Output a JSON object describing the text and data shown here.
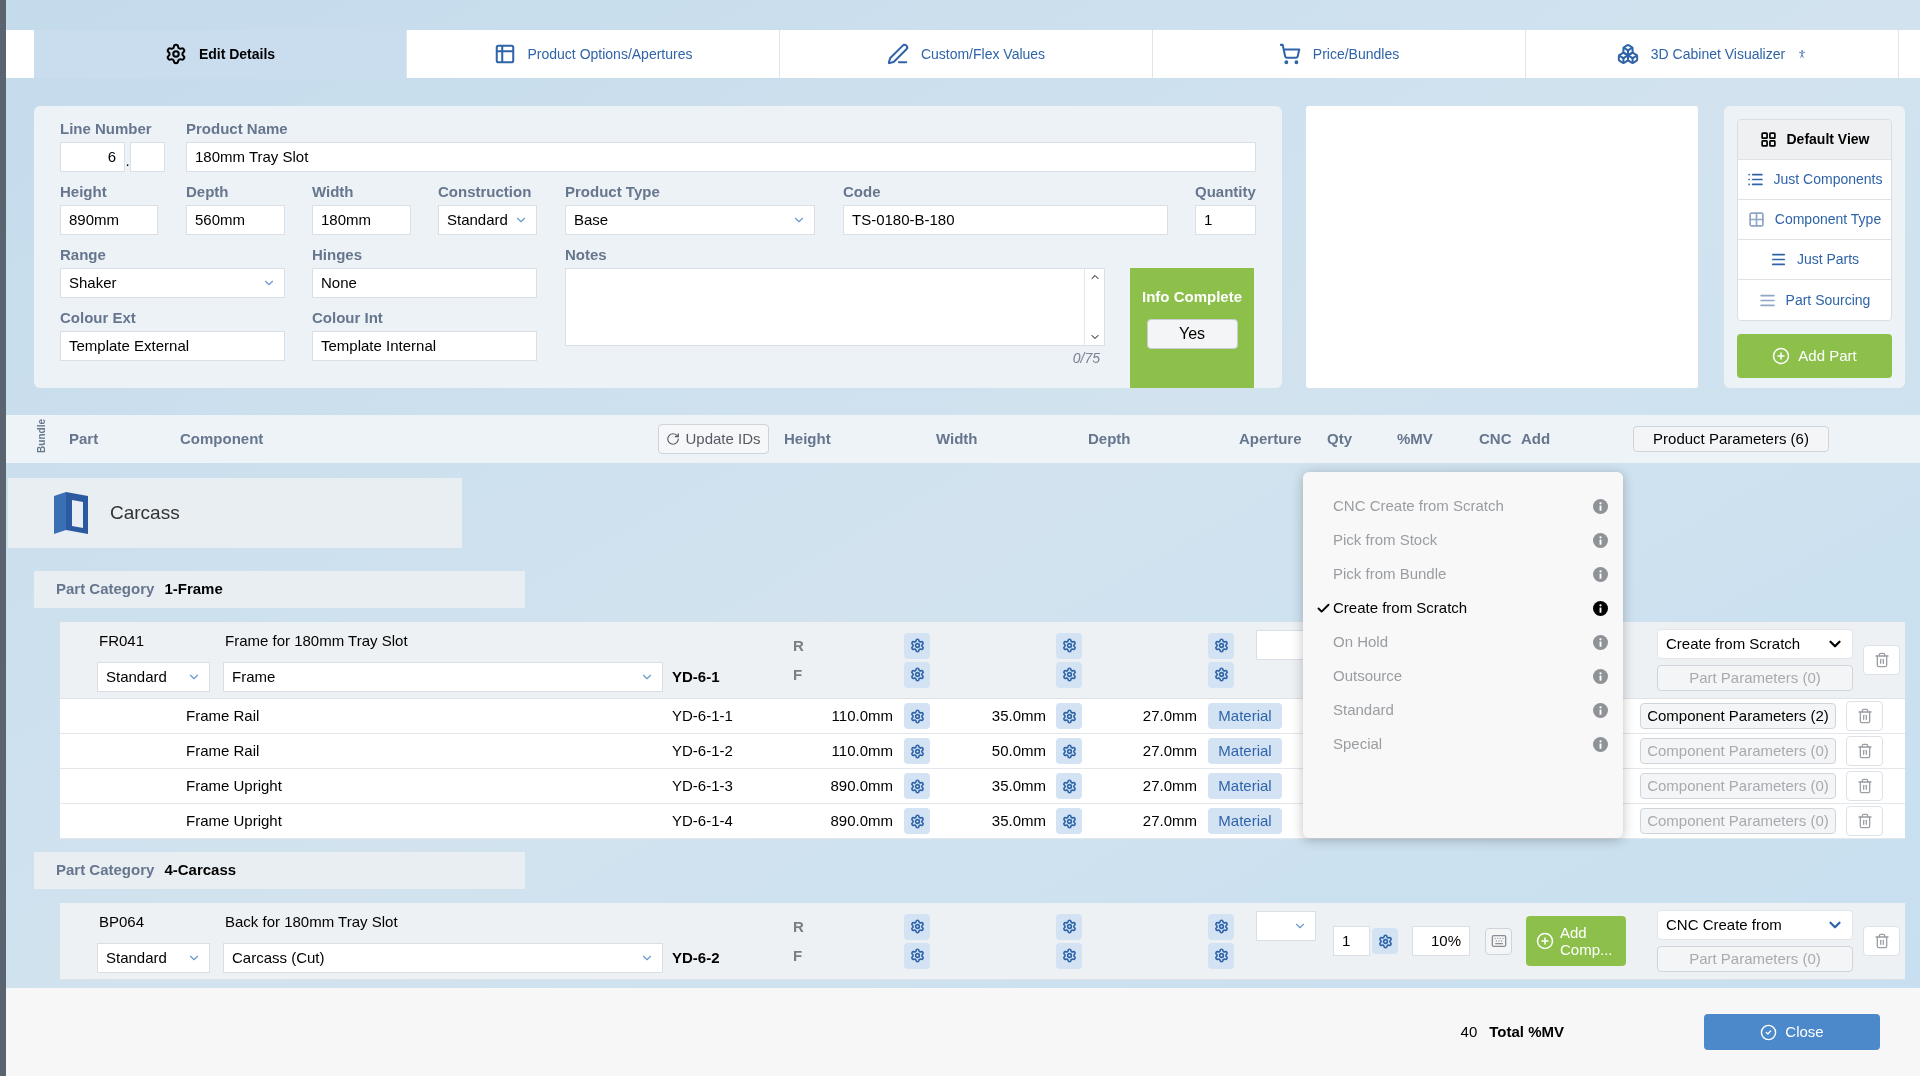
{
  "tabs": [
    {
      "label": "Edit Details",
      "selected": true
    },
    {
      "label": "Product Options/Apertures",
      "selected": false
    },
    {
      "label": "Custom/Flex Values",
      "selected": false
    },
    {
      "label": "Price/Bundles",
      "selected": false
    },
    {
      "label": "3D Cabinet Visualizer",
      "selected": false
    }
  ],
  "form": {
    "line_number": {
      "label": "Line Number",
      "value": "6",
      "separator": "."
    },
    "product_name": {
      "label": "Product Name",
      "value": "180mm Tray Slot"
    },
    "height": {
      "label": "Height",
      "value": "890mm"
    },
    "depth": {
      "label": "Depth",
      "value": "560mm"
    },
    "width": {
      "label": "Width",
      "value": "180mm"
    },
    "construction": {
      "label": "Construction",
      "value": "Standard"
    },
    "product_type": {
      "label": "Product Type",
      "value": "Base"
    },
    "code": {
      "label": "Code",
      "value": "TS-0180-B-180"
    },
    "quantity": {
      "label": "Quantity",
      "value": "1"
    },
    "range": {
      "label": "Range",
      "value": "Shaker"
    },
    "hinges": {
      "label": "Hinges",
      "value": "None"
    },
    "colour_ext": {
      "label": "Colour Ext",
      "value": "Template External"
    },
    "colour_int": {
      "label": "Colour Int",
      "value": "Template Internal"
    },
    "notes": {
      "label": "Notes",
      "counter": "0/75"
    }
  },
  "info_complete": {
    "label": "Info Complete",
    "button": "Yes"
  },
  "views": [
    {
      "label": "Default View",
      "selected": true
    },
    {
      "label": "Just Components",
      "selected": false
    },
    {
      "label": "Component Type",
      "selected": false
    },
    {
      "label": "Just Parts",
      "selected": false
    },
    {
      "label": "Part Sourcing",
      "selected": false
    }
  ],
  "add_part": "Add Part",
  "table_header": {
    "bundle": "Bundle",
    "columns": [
      "Part",
      "Component",
      "Height",
      "Width",
      "Depth",
      "Aperture",
      "Qty",
      "%MV",
      "CNC",
      "Add"
    ],
    "update_ids": "Update IDs",
    "product_parameters": "Product Parameters (6)"
  },
  "section": {
    "title": "Carcass"
  },
  "categories": [
    {
      "label": "Part Category",
      "name": "1-Frame",
      "parts": [
        {
          "code": "FR041",
          "description": "Frame for 180mm Tray Slot",
          "construction": "Standard",
          "component_type": "Frame",
          "id": "YD-6-1",
          "row_labels": [
            "R",
            "F"
          ],
          "source": "Create from Scratch",
          "part_parameters": {
            "label": "Part Parameters (0)",
            "disabled": true
          },
          "components": [
            {
              "name": "Frame Rail",
              "id": "YD-6-1-1",
              "height": "110.0mm",
              "width": "35.0mm",
              "depth": "27.0mm",
              "material": "Material",
              "parameters": {
                "label": "Component Parameters (2)",
                "disabled": false
              }
            },
            {
              "name": "Frame Rail",
              "id": "YD-6-1-2",
              "height": "110.0mm",
              "width": "50.0mm",
              "depth": "27.0mm",
              "material": "Material",
              "parameters": {
                "label": "Component Parameters (0)",
                "disabled": true
              }
            },
            {
              "name": "Frame Upright",
              "id": "YD-6-1-3",
              "height": "890.0mm",
              "width": "35.0mm",
              "depth": "27.0mm",
              "material": "Material",
              "parameters": {
                "label": "Component Parameters (0)",
                "disabled": true
              }
            },
            {
              "name": "Frame Upright",
              "id": "YD-6-1-4",
              "height": "890.0mm",
              "width": "35.0mm",
              "depth": "27.0mm",
              "material": "Material",
              "parameters": {
                "label": "Component Parameters (0)",
                "disabled": true
              }
            }
          ]
        }
      ]
    },
    {
      "label": "Part Category",
      "name": "4-Carcass",
      "parts": [
        {
          "code": "BP064",
          "description": "Back for 180mm Tray Slot",
          "construction": "Standard",
          "component_type": "Carcass (Cut)",
          "id": "YD-6-2",
          "row_labels": [
            "R",
            "F"
          ],
          "qty": "1",
          "mv": "10%",
          "add": "Add Comp...",
          "source": "CNC Create from",
          "part_parameters": {
            "label": "Part Parameters (0)",
            "disabled": true
          }
        }
      ]
    }
  ],
  "source_menu": {
    "options": [
      {
        "label": "CNC Create from Scratch",
        "selected": false
      },
      {
        "label": "Pick from Stock",
        "selected": false
      },
      {
        "label": "Pick from Bundle",
        "selected": false
      },
      {
        "label": "Create from Scratch",
        "selected": true
      },
      {
        "label": "On Hold",
        "selected": false
      },
      {
        "label": "Outsource",
        "selected": false
      },
      {
        "label": "Standard",
        "selected": false
      },
      {
        "label": "Special",
        "selected": false
      }
    ]
  },
  "footer": {
    "total_value": "40",
    "total_label": "Total %MV",
    "close": "Close"
  }
}
